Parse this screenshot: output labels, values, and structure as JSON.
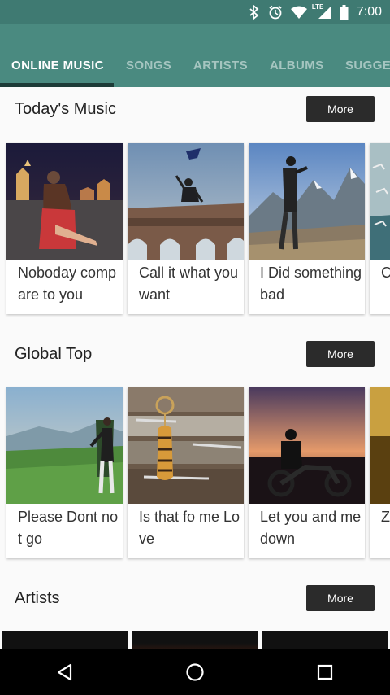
{
  "status": {
    "time": "7:00",
    "network": "LTE"
  },
  "tabs": [
    {
      "label": "ONLINE MUSIC"
    },
    {
      "label": "SONGS"
    },
    {
      "label": "ARTISTS"
    },
    {
      "label": "ALBUMS"
    },
    {
      "label": "SUGGES"
    }
  ],
  "sections": [
    {
      "title": "Today's Music",
      "more": "More",
      "cards": [
        {
          "caption": "Noboday compare to you"
        },
        {
          "caption": "Call it what you want"
        },
        {
          "caption": "I Did something bad"
        },
        {
          "caption": "C h"
        }
      ]
    },
    {
      "title": "Global Top",
      "more": "More",
      "cards": [
        {
          "caption": "Please Dont not go"
        },
        {
          "caption": "Is that fo me Love"
        },
        {
          "caption": "Let you and me down"
        },
        {
          "caption": "Z p"
        }
      ]
    },
    {
      "title": "Artists",
      "more": "More"
    }
  ],
  "colors": {
    "appbar": "#4a8a80",
    "statusbar": "#3f7a72",
    "indicator": "#1d3b37",
    "button": "#2b2b2b"
  }
}
